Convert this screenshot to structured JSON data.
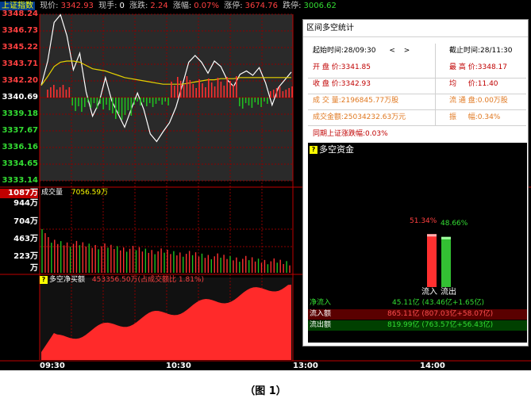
{
  "topbar": {
    "index_name": "上证指数",
    "price_label": "现价:",
    "price": "3342.93",
    "hand_label": "现手:",
    "hand": "0",
    "change_label": "涨跌:",
    "change": "2.24",
    "change_pct_label": "涨幅:",
    "change_pct": "0.07%",
    "limit_up_label": "涨停:",
    "limit_up": "3674.76",
    "limit_down_label": "跌停:",
    "limit_down": "3006.62"
  },
  "price_axis": {
    "labels": [
      "3348.24",
      "3346.73",
      "3345.22",
      "3343.71",
      "3342.20",
      "3340.69",
      "3339.18",
      "3337.67",
      "3336.16",
      "3334.65",
      "3333.14"
    ],
    "colors": [
      "#ff4040",
      "#ff4040",
      "#ff4040",
      "#ff4040",
      "#ff4040",
      "#ffffff",
      "#33dd33",
      "#33dd33",
      "#33dd33",
      "#33dd33",
      "#33dd33"
    ]
  },
  "volume_panel": {
    "label": "成交量",
    "value": "7056.59万",
    "axis": [
      "1087万",
      "944万",
      "704万",
      "463万",
      "223万",
      "万"
    ]
  },
  "netbuy_panel": {
    "label": "多空净买额",
    "value": "453356.50万(占成交额比 1.81%)"
  },
  "time_axis": {
    "labels": [
      "09:30",
      "10:30",
      "13:00",
      "14:00"
    ]
  },
  "dialog": {
    "title": "区间多空统计",
    "start_label": "起始时间:",
    "start_value": "28/09:30",
    "nav_prev": "<",
    "nav_next": ">",
    "end_label": "截止时间:",
    "end_value": "28/11:30",
    "open_label": "开 盘 价:",
    "open_value": "3341.85",
    "high_label": "最 高 价:",
    "high_value": "3348.17",
    "close_label": "收 盘 价:",
    "close_value": "3342.93",
    "avg_label": "均 　 价:",
    "avg_value": "11.40",
    "vol_label": "成 交 量:",
    "vol_value": "2196845.77万股",
    "float_label": "流 通 盘:",
    "float_value": "0.00万股",
    "amount_label": "成交金额:",
    "amount_value": "25034232.63万元",
    "amp_label": "振 　 幅:",
    "amp_value": "0.34%",
    "period_label": "同期上证涨跌幅:",
    "period_value": "0.03%",
    "fund": {
      "title": "多空资金",
      "inflow_pct": "51.34%",
      "outflow_pct": "48.66%",
      "inflow_label": "流入",
      "outflow_label": "流出",
      "inflow_ratio": 0.5134,
      "outflow_ratio": 0.4866,
      "net_label": "净流入",
      "net_value": "45.11亿 (43.46亿+1.65亿)",
      "in_label": "流入额",
      "in_value": "865.11亿 (807.03亿+58.07亿)",
      "out_label": "流出额",
      "out_value": "819.99亿 (763.57亿+56.43亿)"
    }
  },
  "caption": "（图 1）",
  "chart_data": {
    "type": "line",
    "title": "上证指数",
    "yrange": [
      3333.14,
      3348.24
    ],
    "series": [
      {
        "values": [
          3341.8,
          3344.0,
          3347.5,
          3348.2,
          3346.3,
          3343.2,
          3344.7,
          3341.2,
          3339.0,
          3340.2,
          3342.5,
          3340.4,
          3339.2,
          3338.0,
          3339.6,
          3341.1,
          3339.6,
          3337.4,
          3336.7,
          3337.6,
          3338.4,
          3339.8,
          3341.8,
          3343.9,
          3344.5,
          3343.9,
          3342.9,
          3344.0,
          3343.5,
          3342.3,
          3341.7,
          3342.8,
          3343.1,
          3342.7,
          3343.4,
          3342.0,
          3340.0,
          3341.6,
          3342.3,
          3343.0
        ]
      },
      {
        "values": [
          3341.8,
          3342.6,
          3343.5,
          3343.9,
          3344.0,
          3344.0,
          3343.9,
          3343.6,
          3343.3,
          3343.2,
          3343.1,
          3342.9,
          3342.7,
          3342.5,
          3342.4,
          3342.3,
          3342.2,
          3342.1,
          3342.0,
          3341.9,
          3341.9,
          3341.9,
          3341.9,
          3342.0,
          3342.1,
          3342.2,
          3342.3,
          3342.3,
          3342.4,
          3342.4,
          3342.4,
          3342.5,
          3342.5,
          3342.5,
          3342.5,
          3342.5,
          3342.5,
          3342.5,
          3342.5,
          3342.5
        ]
      }
    ]
  }
}
